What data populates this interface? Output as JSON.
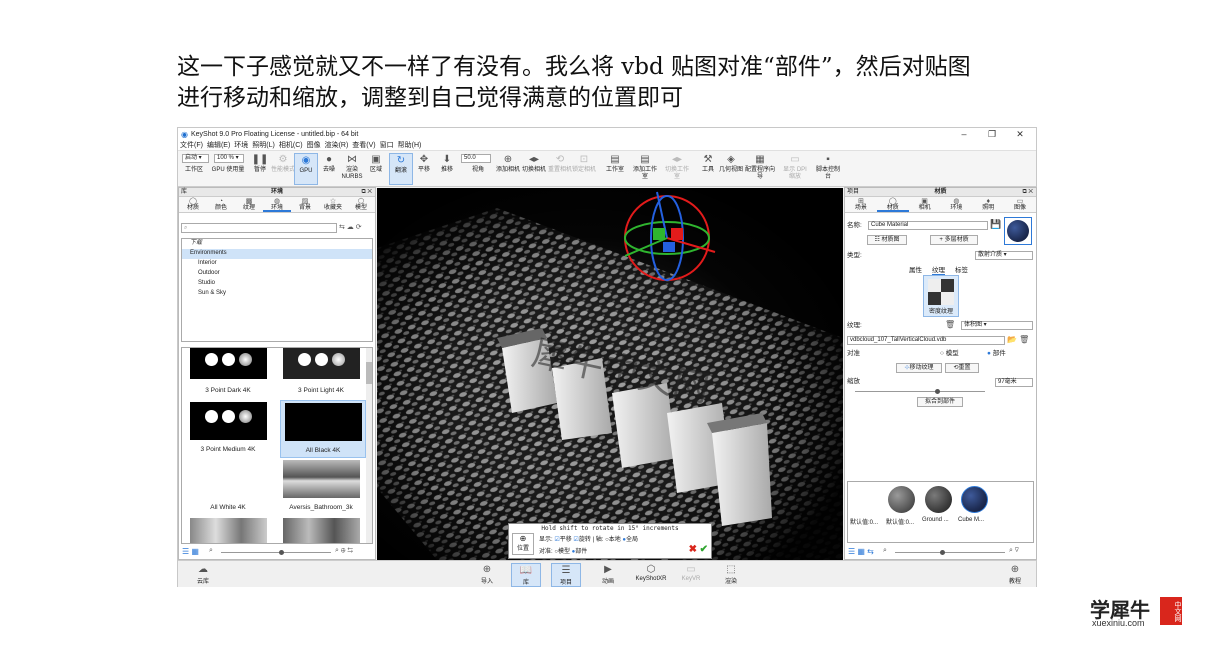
{
  "caption": {
    "line1": "这一下子感觉就又不一样了有没有。我么将 vbd 贴图对准“部件”，然后对贴图",
    "line2": "进行移动和缩放，调整到自己觉得满意的位置即可"
  },
  "window": {
    "title": "KeyShot 9.0 Pro Floating License - untitled.bip - 64 bit",
    "controls": [
      "–",
      "❐",
      "✕"
    ]
  },
  "menu": [
    "文件(F)",
    "编辑(E)",
    "环境",
    "照明(L)",
    "相机(C)",
    "图像",
    "渲染(R)",
    "查看(V)",
    "窗口",
    "帮助(H)"
  ],
  "toolbar": {
    "mode_select": "启动 ▾",
    "zoom_select": "100 % ▾",
    "fps": "50.0",
    "buttons": [
      {
        "label": "工作区",
        "icon": "workspace-icon"
      },
      {
        "label": "GPU 使用量",
        "icon": "gpu-usage-icon"
      },
      {
        "label": "暂停",
        "icon": "pause-icon"
      },
      {
        "label": "性能模式",
        "icon": "performance-icon"
      },
      {
        "label": "GPU",
        "icon": "gpu-icon"
      },
      {
        "label": "去噪",
        "icon": "denoise-icon"
      },
      {
        "label": "渲染 NURBS",
        "icon": "nurbs-icon"
      },
      {
        "label": "区域",
        "icon": "region-icon"
      },
      {
        "label": "翻滚",
        "icon": "tumble-icon"
      },
      {
        "label": "平移",
        "icon": "pan-icon"
      },
      {
        "label": "推移",
        "icon": "dolly-icon"
      },
      {
        "label": "视角",
        "icon": "fov-icon"
      },
      {
        "label": "添加相机",
        "icon": "add-camera-icon"
      },
      {
        "label": "切换相机",
        "icon": "switch-camera-icon"
      },
      {
        "label": "重置相机",
        "icon": "reset-camera-icon"
      },
      {
        "label": "锁定相机",
        "icon": "lock-camera-icon"
      },
      {
        "label": "工作室",
        "icon": "studio-icon"
      },
      {
        "label": "添加工作室",
        "icon": "add-studio-icon"
      },
      {
        "label": "切换工作室",
        "icon": "switch-studio-icon"
      },
      {
        "label": "工具",
        "icon": "tools-icon"
      },
      {
        "label": "几何视图",
        "icon": "geometry-view-icon"
      },
      {
        "label": "配置程序向导",
        "icon": "configurator-icon"
      },
      {
        "label": "显示 DPI 缩放",
        "icon": "dpi-icon"
      },
      {
        "label": "脚本控制台",
        "icon": "script-console-icon"
      }
    ]
  },
  "library": {
    "header_left": "库",
    "header_center": "环境",
    "tabs": [
      "材质",
      "颜色",
      "纹理",
      "环境",
      "背景",
      "收藏夹",
      "模型"
    ],
    "active_tab": 3,
    "search_placeholder": "",
    "tree": [
      {
        "label": "下载",
        "indent": 0
      },
      {
        "label": "Environments",
        "indent": 0
      },
      {
        "label": "Interior",
        "indent": 1
      },
      {
        "label": "Outdoor",
        "indent": 1
      },
      {
        "label": "Studio",
        "indent": 1
      },
      {
        "label": "Sun & Sky",
        "indent": 1
      }
    ],
    "thumbnails": [
      "3 Point Dark 4K",
      "3 Point Light 4K",
      "3 Point Medium 4K",
      "All Black 4K",
      "All White 4K",
      "Aversis_Bathroom_3k"
    ]
  },
  "hud": {
    "hint": "Hold shift to rotate in 15° increments",
    "position_label": "位置",
    "display_label": "显示:",
    "translate": "平移",
    "rotate": "旋转",
    "axis_label": "轴:",
    "local": "本地",
    "global": "全局",
    "align_label": "对准:",
    "model": "模型",
    "part": "部件"
  },
  "project": {
    "header_left": "项目",
    "header_center": "材质",
    "tabs": [
      "场景",
      "材质",
      "相机",
      "环境",
      "照明",
      "图像"
    ],
    "active_tab": 1,
    "name_label": "名称:",
    "name_value": "Cube Material",
    "material_graph_btn": "材质图",
    "multi_material_btn": "多层材质",
    "type_label": "类型:",
    "type_value": "散射介质",
    "subtabs": [
      "属性",
      "纹理",
      "标签"
    ],
    "active_subtab": 1,
    "swatch_label": "密度纹理",
    "texture_label": "纹理:",
    "texture_type": "体积图",
    "texture_file": "vdbcloud_107_TallVerticalCloud.vdb",
    "align_label": "对准",
    "align_model": "模型",
    "align_part": "部件",
    "move_texture_btn": "移动纹理",
    "reset_btn": "重置",
    "scale_label": "缩放",
    "scale_value": "97毫米",
    "fit_to_part_btn": "拟合到部件",
    "materials": [
      "默认值:0...",
      "默认值:0...",
      "Ground ...",
      "Cube M..."
    ],
    "material_colors": [
      "#6b6b6b",
      "#4a4a4a",
      "#3a3a3a",
      "#1e2d55"
    ]
  },
  "bottom": {
    "cloud_library": "云库",
    "import": "导入",
    "library": "库",
    "project": "项目",
    "animation": "动画",
    "keyshotxr": "KeyShotXR",
    "keyve": "KeyVR",
    "render": "渲染",
    "tutorial": "教程"
  },
  "viewport_text": "犀牛中文网",
  "watermark": {
    "big": "学犀牛",
    "badge": "中文网",
    "url": "xuexiniu.com"
  },
  "colors": {
    "accent": "#2d79d8",
    "selection": "#cfe3f8",
    "badge_red": "#d9261c"
  }
}
